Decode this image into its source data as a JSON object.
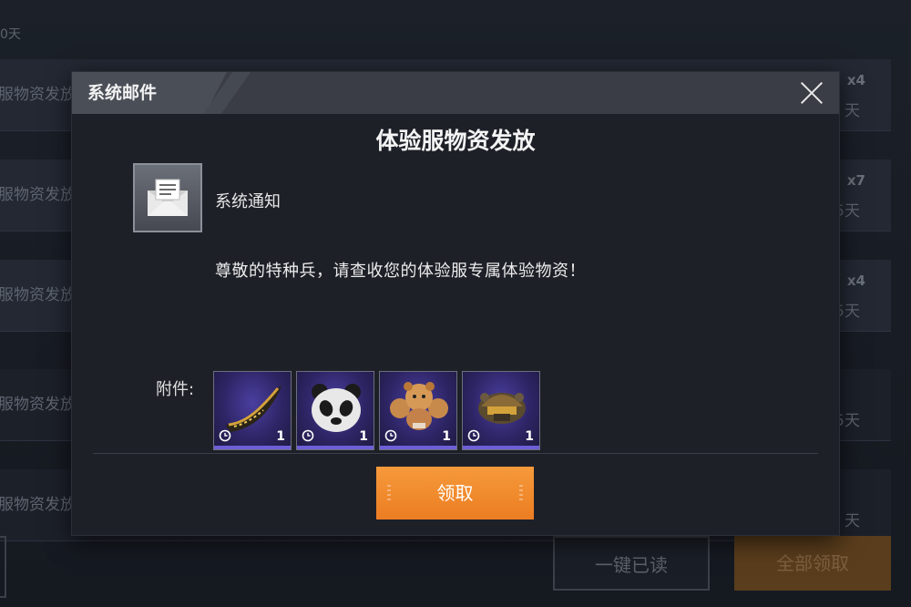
{
  "background": {
    "top_text": "0天",
    "rows": [
      {
        "title": "服物资发放",
        "quantity": "x4",
        "days": "天"
      },
      {
        "title": "服物资发放",
        "quantity": "x7",
        "days": "5天"
      },
      {
        "title": "服物资发放",
        "quantity": "x4",
        "days": "5天"
      },
      {
        "title": "服物资发放",
        "quantity": "",
        "days": "5天"
      },
      {
        "title": "服物资发放",
        "quantity": "",
        "days": "天"
      }
    ],
    "read_all_label": "一键已读",
    "claim_all_label": "全部领取"
  },
  "modal": {
    "header_title": "系统邮件",
    "mail_title": "体验服物资发放",
    "sender": "系统通知",
    "message": "尊敬的特种兵，请查收您的体验服专属体验物资！",
    "attachments_label": "附件:",
    "attachments": [
      {
        "icon": "gold-banana-icon",
        "quantity": "1"
      },
      {
        "icon": "panda-mask-icon",
        "quantity": "1"
      },
      {
        "icon": "muscle-bear-icon",
        "quantity": "1"
      },
      {
        "icon": "helmet-icon",
        "quantity": "1"
      }
    ],
    "claim_label": "领取"
  },
  "colors": {
    "accent_orange": "#f08a2c",
    "item_purple": "#6d5fd8"
  }
}
